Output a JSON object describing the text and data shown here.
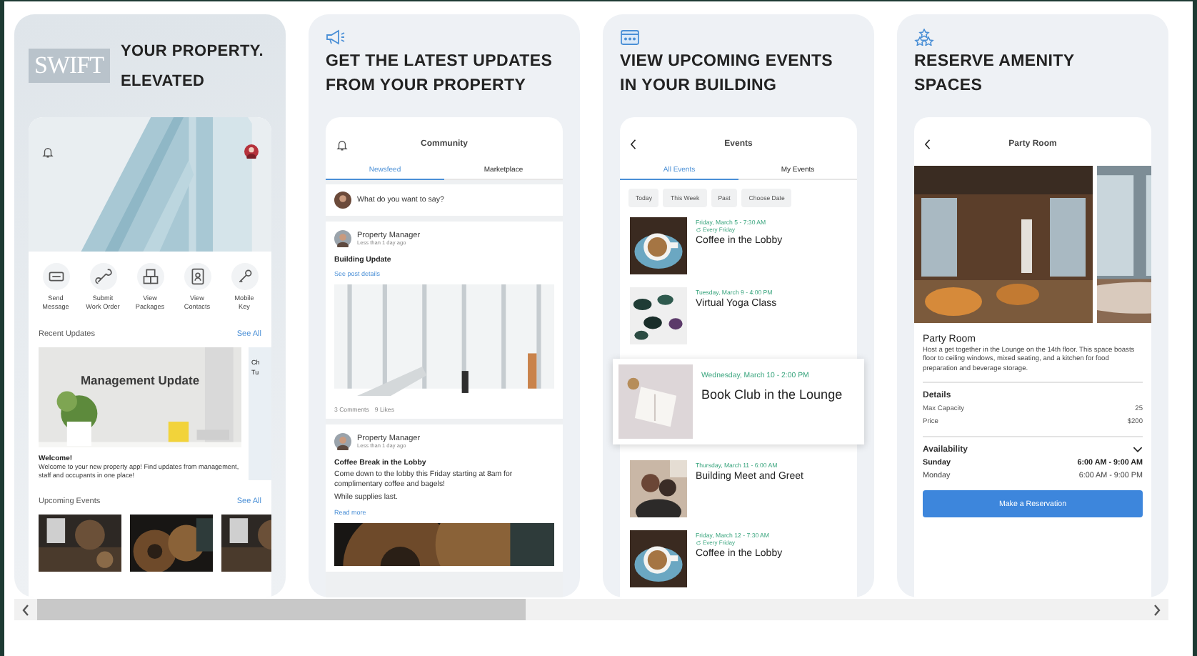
{
  "panels": [
    {
      "kind": "home",
      "logo": "SWIFT",
      "headline": [
        "YOUR PROPERTY.",
        "ELEVATED"
      ],
      "actions": [
        {
          "label": "Send\nMessage"
        },
        {
          "label": "Submit\nWork Order"
        },
        {
          "label": "View\nPackages"
        },
        {
          "label": "View\nContacts"
        },
        {
          "label": "Mobile\nKey"
        }
      ],
      "recent": {
        "title": "Recent Updates",
        "link": "See All"
      },
      "update": {
        "caption": "Management Update",
        "title": "Welcome!",
        "body": "Welcome to your new property app! Find updates from management, staff and occupants in one place!"
      },
      "peek": [
        "Ch",
        "Tu"
      ],
      "upcoming": {
        "title": "Upcoming Events",
        "link": "See All"
      }
    },
    {
      "kind": "feed",
      "headline": [
        "GET THE LATEST UPDATES",
        "FROM YOUR PROPERTY"
      ],
      "title": "Community",
      "tabs": [
        {
          "label": "Newsfeed",
          "selected": true
        },
        {
          "label": "Marketplace",
          "selected": false
        }
      ],
      "composer": {
        "placeholder": "What do you want to say?"
      },
      "posts": [
        {
          "author": "Property Manager",
          "time": "Less than 1 day ago",
          "title": "Building Update",
          "link": "See post details",
          "stats": [
            "3 Comments",
            "9 Likes"
          ]
        },
        {
          "author": "Property Manager",
          "time": "Less than 1 day ago",
          "title": "Coffee Break in the Lobby",
          "body": [
            "Come down to the lobby this Friday starting at 8am for complimentary coffee and bagels!",
            "While supplies last."
          ],
          "link": "Read more"
        }
      ]
    },
    {
      "kind": "events",
      "headline": [
        "VIEW UPCOMING EVENTS",
        "IN YOUR BUILDING"
      ],
      "title": "Events",
      "tabs": [
        {
          "label": "All Events",
          "selected": true
        },
        {
          "label": "My Events",
          "selected": false
        }
      ],
      "filters": [
        "Today",
        "This Week",
        "Past",
        "Choose Date"
      ],
      "events": [
        {
          "date": "Friday, March 5 - 7:30 AM",
          "repeat": "Every Friday",
          "title": "Coffee in the Lobby",
          "highlighted": false
        },
        {
          "date": "Tuesday, March 9 - 4:00 PM",
          "title": "Virtual Yoga Class",
          "highlighted": false
        },
        {
          "date": "Wednesday, March 10 - 2:00 PM",
          "title": "Book Club in the Lounge",
          "highlighted": true
        },
        {
          "date": "Thursday, March 11 - 6:00 AM",
          "title": "Building Meet and Greet",
          "highlighted": false
        },
        {
          "date": "Friday, March 12 - 7:30 AM",
          "repeat": "Every Friday",
          "title": "Coffee in the Lobby",
          "highlighted": false
        }
      ]
    },
    {
      "kind": "amenity",
      "headline": [
        "RESERVE AMENITY",
        "SPACES"
      ],
      "title": "Party Room",
      "name": "Party Room",
      "description": "Host a get together in the Lounge on the 14th floor. This space boasts floor to ceiling windows, mixed seating, and a kitchen for food preparation and beverage storage.",
      "details_title": "Details",
      "details": [
        {
          "label": "Max Capacity",
          "value": "25"
        },
        {
          "label": "Price",
          "value": "$200"
        }
      ],
      "availability_title": "Availability",
      "expanded": true,
      "hours": [
        {
          "day": "Sunday",
          "time": "6:00 AM - 9:00 AM",
          "selected": true
        },
        {
          "day": "Monday",
          "time": "6:00 AM - 9:00 PM",
          "selected": false
        }
      ],
      "button": "Make a Reservation"
    }
  ]
}
